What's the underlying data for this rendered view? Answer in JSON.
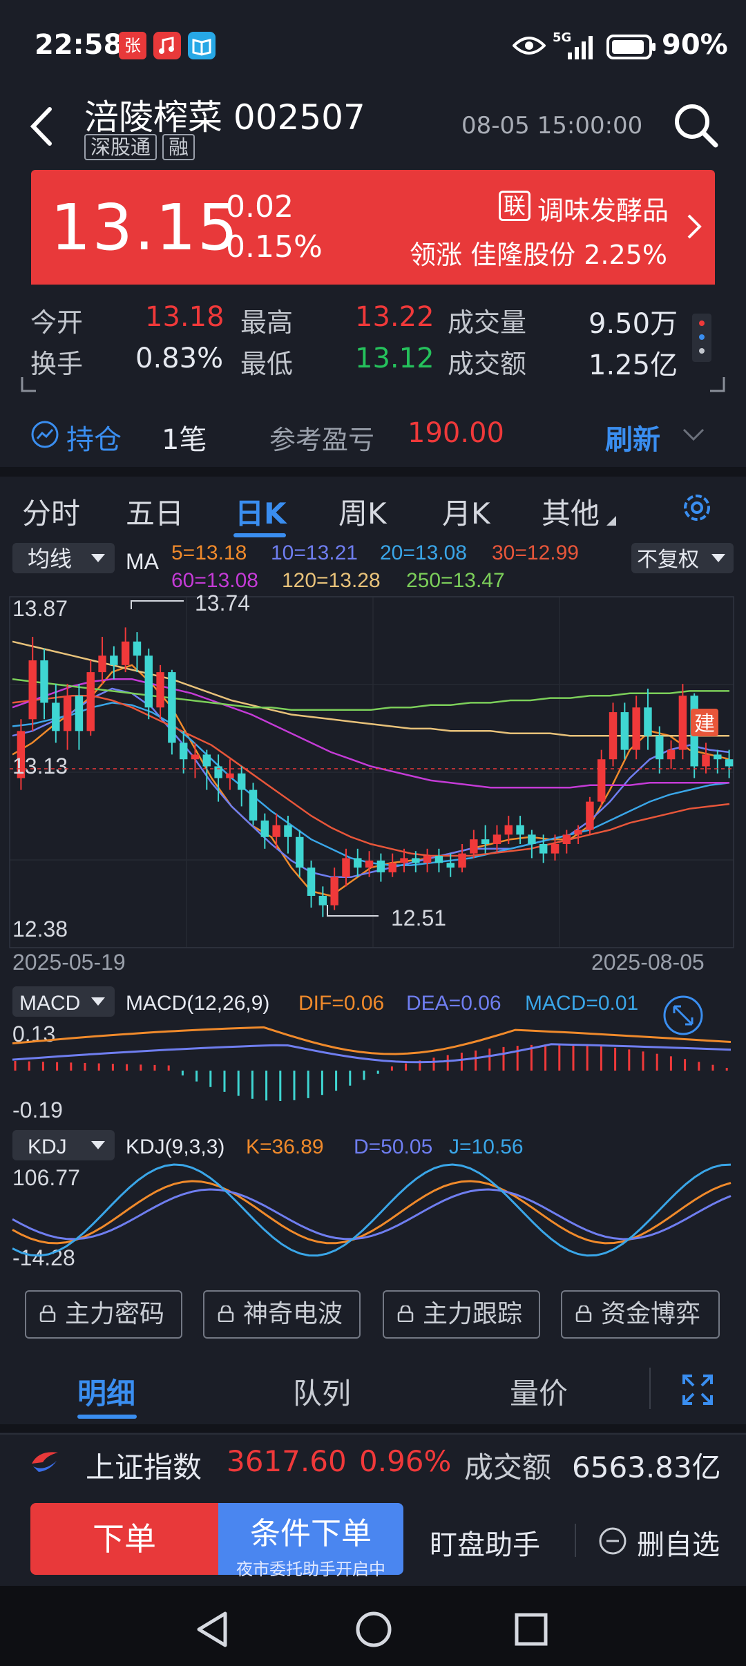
{
  "status": {
    "time": "22:58",
    "network": "5G",
    "battery": "90%"
  },
  "header": {
    "title": "涪陵榨菜 002507",
    "tags": [
      "深股通",
      "融"
    ],
    "datetime": "08-05 15:00:00"
  },
  "quote": {
    "price": "13.15",
    "change": "0.02",
    "change_pct": "0.15%",
    "sector_badge": "联",
    "sector": "调味发酵品",
    "lead_label": "领涨",
    "lead_stock": "佳隆股份",
    "lead_pct": "2.25%"
  },
  "stats": {
    "open_label": "今开",
    "open": "13.18",
    "high_label": "最高",
    "high": "13.22",
    "vol_label": "成交量",
    "vol": "9.50万",
    "turnover_label": "换手",
    "turnover": "0.83%",
    "low_label": "最低",
    "low": "13.12",
    "amount_label": "成交额",
    "amount": "1.25亿"
  },
  "holding": {
    "label": "持仓",
    "count": "1笔",
    "pnl_label": "参考盈亏",
    "pnl": "190.00",
    "refresh": "刷新"
  },
  "tabs": {
    "t1": "分时",
    "t2": "五日",
    "t3": "日K",
    "t4": "周K",
    "t5": "月K",
    "t6": "其他"
  },
  "kline": {
    "ma_select": "均线",
    "ma_label": "MA",
    "adjust": "不复权",
    "ma5": "5=13.18",
    "ma10": "10=13.21",
    "ma20": "20=13.08",
    "ma30": "30=12.99",
    "ma60": "60=13.08",
    "ma120": "120=13.28",
    "ma250": "250=13.47",
    "y_top": "13.87",
    "y_mid": "13.13",
    "y_bottom": "12.38",
    "max_note": "13.74",
    "min_note": "12.51",
    "date_start": "2025-05-19",
    "date_end": "2025-08-05",
    "marker": "建"
  },
  "macd": {
    "select": "MACD",
    "label": "MACD(12,26,9)",
    "dif": "DIF=0.06",
    "dea": "DEA=0.06",
    "macd": "MACD=0.01",
    "y_top": "0.13",
    "y_bottom": "-0.19"
  },
  "kdj": {
    "select": "KDJ",
    "label": "KDJ(9,3,3)",
    "k": "K=36.89",
    "d": "D=50.05",
    "j": "J=10.56",
    "y_top": "106.77",
    "y_bottom": "-14.28"
  },
  "features": {
    "f1": "主力密码",
    "f2": "神奇电波",
    "f3": "主力跟踪",
    "f4": "资金博弈"
  },
  "detail_tabs": {
    "d1": "明细",
    "d2": "队列",
    "d3": "量价"
  },
  "index": {
    "name": "上证指数",
    "value": "3617.60",
    "pct": "0.96%",
    "amount_label": "成交额",
    "amount": "6563.83亿"
  },
  "actions": {
    "order": "下单",
    "cond_order": "条件下单",
    "cond_sub": "夜市委托助手开启中",
    "monitor": "盯盘助手",
    "remove": "删自选"
  },
  "colors": {
    "up": "#f0393a",
    "down": "#3fd6d2",
    "accent": "#3a8ef0",
    "ma5": "#f08a2b",
    "ma10": "#6f7ef0",
    "ma20": "#3aa6e8",
    "ma30": "#e8563a",
    "ma60": "#c43bd6",
    "ma120": "#e8c27a",
    "ma250": "#7ccf5a"
  },
  "chart_data": {
    "type": "candlestick",
    "x_start": "2025-05-19",
    "x_end": "2025-08-05",
    "ylim": [
      12.38,
      13.87
    ],
    "candles": [
      [
        13.1,
        13.3,
        13.05,
        13.35
      ],
      [
        13.35,
        13.6,
        13.3,
        13.7
      ],
      [
        13.6,
        13.42,
        13.35,
        13.65
      ],
      [
        13.42,
        13.3,
        13.25,
        13.5
      ],
      [
        13.3,
        13.45,
        13.22,
        13.5
      ],
      [
        13.45,
        13.3,
        13.22,
        13.5
      ],
      [
        13.3,
        13.55,
        13.28,
        13.6
      ],
      [
        13.55,
        13.62,
        13.5,
        13.7
      ],
      [
        13.62,
        13.58,
        13.52,
        13.66
      ],
      [
        13.58,
        13.68,
        13.55,
        13.74
      ],
      [
        13.68,
        13.62,
        13.55,
        13.72
      ],
      [
        13.62,
        13.4,
        13.35,
        13.65
      ],
      [
        13.4,
        13.55,
        13.35,
        13.58
      ],
      [
        13.55,
        13.25,
        13.2,
        13.56
      ],
      [
        13.25,
        13.18,
        13.12,
        13.3
      ],
      [
        13.18,
        13.2,
        13.1,
        13.25
      ],
      [
        13.2,
        13.15,
        13.05,
        13.22
      ],
      [
        13.15,
        13.1,
        13.0,
        13.2
      ],
      [
        13.1,
        13.12,
        13.05,
        13.18
      ],
      [
        13.12,
        13.05,
        12.98,
        13.15
      ],
      [
        13.05,
        12.92,
        12.9,
        13.08
      ],
      [
        12.92,
        12.85,
        12.8,
        12.95
      ],
      [
        12.85,
        12.9,
        12.8,
        12.95
      ],
      [
        12.9,
        12.85,
        12.78,
        12.94
      ],
      [
        12.85,
        12.72,
        12.68,
        12.88
      ],
      [
        12.72,
        12.6,
        12.55,
        12.75
      ],
      [
        12.6,
        12.56,
        12.51,
        12.64
      ],
      [
        12.56,
        12.68,
        12.54,
        12.72
      ],
      [
        12.68,
        12.76,
        12.64,
        12.8
      ],
      [
        12.76,
        12.72,
        12.68,
        12.8
      ],
      [
        12.72,
        12.75,
        12.68,
        12.79
      ],
      [
        12.75,
        12.7,
        12.66,
        12.78
      ],
      [
        12.7,
        12.74,
        12.68,
        12.78
      ],
      [
        12.74,
        12.76,
        12.7,
        12.8
      ],
      [
        12.76,
        12.74,
        12.7,
        12.79
      ],
      [
        12.74,
        12.77,
        12.7,
        12.8
      ],
      [
        12.77,
        12.74,
        12.7,
        12.8
      ],
      [
        12.74,
        12.72,
        12.68,
        12.78
      ],
      [
        12.72,
        12.78,
        12.7,
        12.82
      ],
      [
        12.78,
        12.84,
        12.76,
        12.88
      ],
      [
        12.84,
        12.82,
        12.78,
        12.9
      ],
      [
        12.82,
        12.86,
        12.78,
        12.9
      ],
      [
        12.86,
        12.9,
        12.82,
        12.94
      ],
      [
        12.9,
        12.86,
        12.82,
        12.94
      ],
      [
        12.86,
        12.82,
        12.76,
        12.88
      ],
      [
        12.82,
        12.78,
        12.74,
        12.86
      ],
      [
        12.78,
        12.82,
        12.75,
        12.86
      ],
      [
        12.82,
        12.86,
        12.78,
        12.88
      ],
      [
        12.86,
        12.88,
        12.82,
        12.9
      ],
      [
        12.88,
        13.0,
        12.86,
        13.02
      ],
      [
        13.0,
        13.18,
        12.98,
        13.22
      ],
      [
        13.18,
        13.38,
        13.15,
        13.42
      ],
      [
        13.38,
        13.22,
        13.18,
        13.42
      ],
      [
        13.22,
        13.4,
        13.18,
        13.45
      ],
      [
        13.4,
        13.28,
        13.22,
        13.48
      ],
      [
        13.28,
        13.18,
        13.12,
        13.32
      ],
      [
        13.18,
        13.22,
        13.14,
        13.26
      ],
      [
        13.22,
        13.45,
        13.18,
        13.5
      ],
      [
        13.45,
        13.15,
        13.1,
        13.46
      ],
      [
        13.15,
        13.2,
        13.12,
        13.25
      ],
      [
        13.2,
        13.18,
        13.12,
        13.22
      ],
      [
        13.18,
        13.15,
        13.1,
        13.22
      ]
    ],
    "ma_series": {
      "ma5": [
        13.2,
        13.25,
        13.32,
        13.38,
        13.45,
        13.55,
        13.58,
        13.5,
        13.4,
        13.25,
        13.1,
        12.98,
        12.9,
        12.85,
        12.72,
        12.62,
        12.6,
        12.66,
        12.72,
        12.74,
        12.75,
        12.76,
        12.78,
        12.8,
        12.82,
        12.84,
        12.85,
        12.84,
        12.84,
        12.9,
        13.05,
        13.22,
        13.3,
        13.28,
        13.22,
        13.2,
        13.18
      ],
      "ma10": [
        13.28,
        13.3,
        13.34,
        13.38,
        13.44,
        13.48,
        13.46,
        13.4,
        13.3,
        13.2,
        13.08,
        12.98,
        12.9,
        12.82,
        12.75,
        12.7,
        12.68,
        12.68,
        12.7,
        12.72,
        12.74,
        12.76,
        12.78,
        12.8,
        12.8,
        12.8,
        12.82,
        12.84,
        12.86,
        12.92,
        13.0,
        13.1,
        13.18,
        13.22,
        13.24,
        13.22,
        13.21
      ],
      "ma20": [
        13.32,
        13.33,
        13.35,
        13.37,
        13.4,
        13.42,
        13.41,
        13.38,
        13.33,
        13.26,
        13.18,
        13.1,
        13.03,
        12.96,
        12.9,
        12.84,
        12.8,
        12.76,
        12.74,
        12.73,
        12.73,
        12.74,
        12.75,
        12.76,
        12.78,
        12.8,
        12.82,
        12.84,
        12.86,
        12.88,
        12.92,
        12.96,
        13.0,
        13.03,
        13.05,
        13.07,
        13.08
      ],
      "ma30": [
        13.42,
        13.43,
        13.44,
        13.45,
        13.45,
        13.43,
        13.4,
        13.36,
        13.32,
        13.28,
        13.24,
        13.18,
        13.12,
        13.06,
        13.0,
        12.94,
        12.89,
        12.85,
        12.82,
        12.8,
        12.78,
        12.77,
        12.77,
        12.77,
        12.78,
        12.79,
        12.8,
        12.82,
        12.84,
        12.86,
        12.88,
        12.91,
        12.93,
        12.95,
        12.97,
        12.98,
        12.99
      ],
      "ma60": [
        13.4,
        13.43,
        13.46,
        13.49,
        13.51,
        13.52,
        13.52,
        13.5,
        13.48,
        13.46,
        13.43,
        13.4,
        13.37,
        13.33,
        13.29,
        13.25,
        13.21,
        13.18,
        13.15,
        13.13,
        13.11,
        13.09,
        13.08,
        13.07,
        13.06,
        13.06,
        13.06,
        13.06,
        13.06,
        13.07,
        13.07,
        13.07,
        13.08,
        13.08,
        13.08,
        13.08,
        13.08
      ],
      "ma120": [
        13.68,
        13.66,
        13.64,
        13.62,
        13.6,
        13.58,
        13.56,
        13.54,
        13.52,
        13.49,
        13.46,
        13.43,
        13.41,
        13.39,
        13.37,
        13.36,
        13.35,
        13.34,
        13.33,
        13.32,
        13.31,
        13.31,
        13.3,
        13.3,
        13.3,
        13.29,
        13.29,
        13.29,
        13.28,
        13.28,
        13.28,
        13.28,
        13.28,
        13.28,
        13.28,
        13.28,
        13.28
      ],
      "ma250": [
        13.52,
        13.51,
        13.5,
        13.49,
        13.48,
        13.47,
        13.46,
        13.45,
        13.44,
        13.43,
        13.42,
        13.41,
        13.4,
        13.4,
        13.39,
        13.39,
        13.39,
        13.39,
        13.39,
        13.4,
        13.4,
        13.41,
        13.41,
        13.42,
        13.42,
        13.43,
        13.43,
        13.44,
        13.44,
        13.45,
        13.45,
        13.46,
        13.46,
        13.46,
        13.47,
        13.47,
        13.47
      ]
    }
  }
}
